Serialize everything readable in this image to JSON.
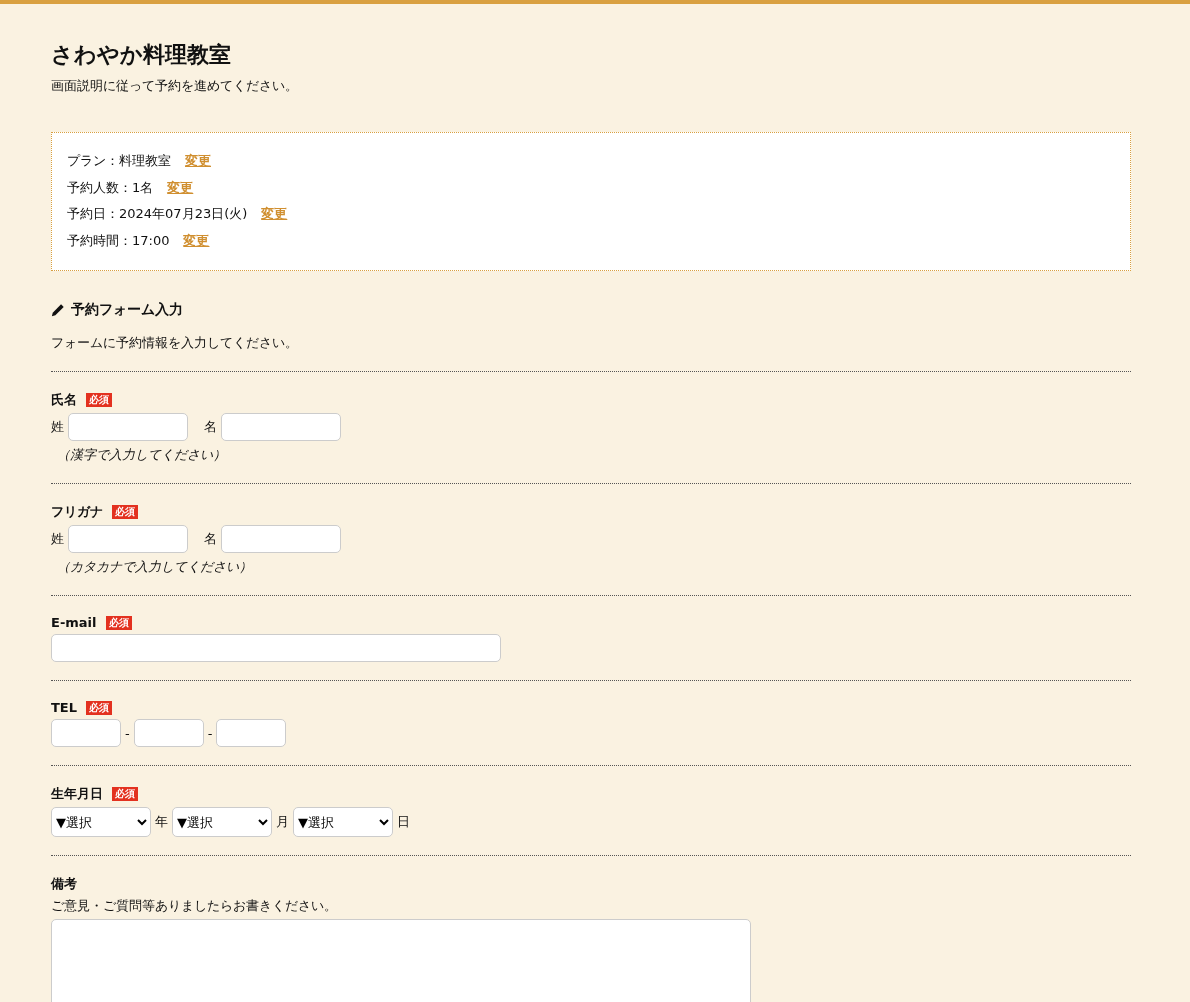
{
  "header": {
    "title": "さわやか料理教室",
    "description": "画面説明に従って予約を進めてください。"
  },
  "summary": [
    {
      "label": "プラン：料理教室",
      "link": "変更"
    },
    {
      "label": "予約人数：1名",
      "link": "変更"
    },
    {
      "label": "予約日：2024年07月23日(火)",
      "link": "変更"
    },
    {
      "label": "予約時間：17:00",
      "link": "変更"
    }
  ],
  "form": {
    "title": "予約フォーム入力",
    "description": "フォームに予約情報を入力してください。",
    "fields": [
      {
        "kind": "split",
        "label": "氏名",
        "required_badge": "必須",
        "parts": [
          "姓",
          "名"
        ],
        "note": "（漢字で入力してください）"
      },
      {
        "kind": "split",
        "label": "フリガナ",
        "required_badge": "必須",
        "parts": [
          "姓",
          "名"
        ],
        "note": "（カタカナで入力してください）"
      },
      {
        "kind": "text",
        "label": "E-mail",
        "required_badge": "必須"
      },
      {
        "kind": "tel",
        "label": "TEL",
        "required_badge": "必須",
        "separators": [
          "-",
          "-"
        ]
      },
      {
        "kind": "date",
        "label": "生年月日",
        "required_badge": "必須",
        "selects": [
          {
            "value": "▼選択",
            "unit": "年"
          },
          {
            "value": "▼選択",
            "unit": "月"
          },
          {
            "value": "▼選択",
            "unit": "日"
          }
        ]
      },
      {
        "kind": "textarea",
        "label": "備考",
        "hint": "ご意見・ご質問等ありましたらお書きください。"
      }
    ]
  }
}
